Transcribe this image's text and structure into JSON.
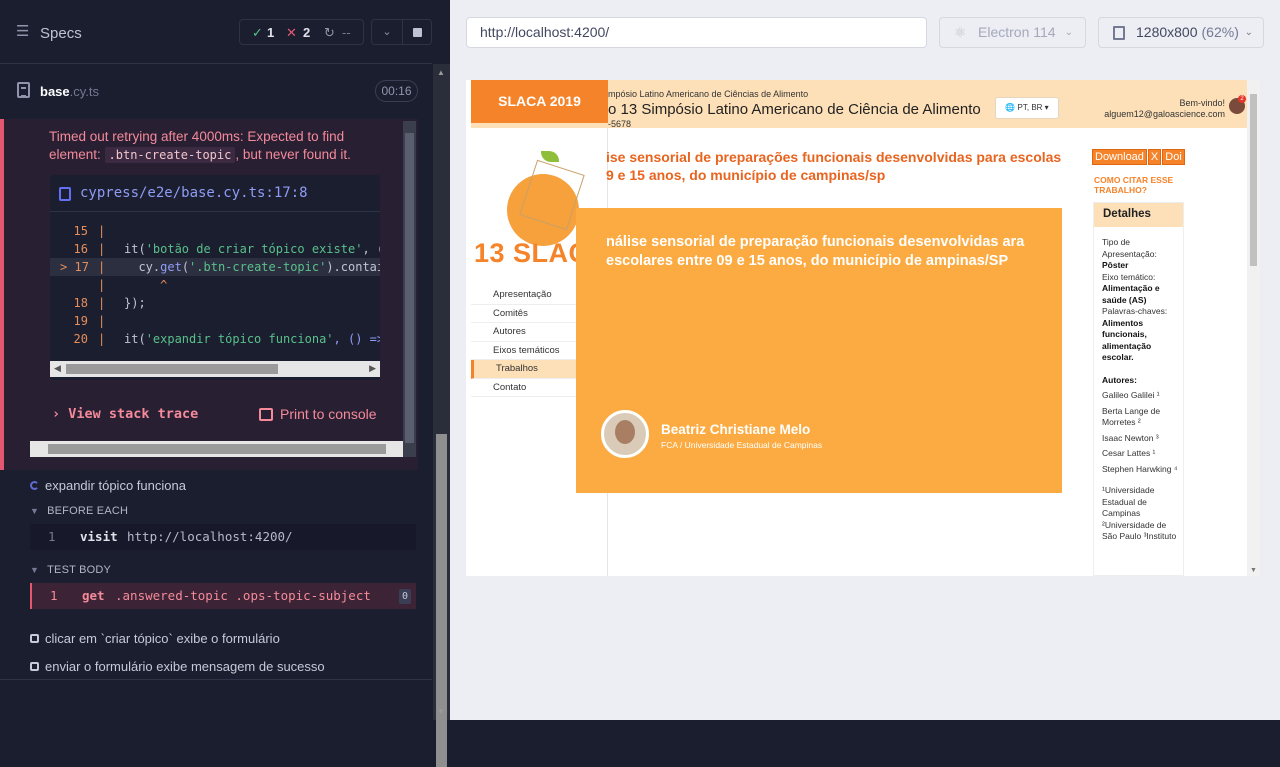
{
  "runner": {
    "specs_label": "Specs",
    "passed": "1",
    "failed": "2",
    "pending": "--",
    "spec_file": "base",
    "spec_ext": ".cy.ts",
    "duration": "00:16"
  },
  "error": {
    "message_before": "Timed out retrying after 4000ms: Expected to find element: ",
    "selector": ".btn-create-topic",
    "message_after": ", but never found it.",
    "file_link": "cypress/e2e/base.cy.ts:17:8",
    "code_lines": [
      {
        "num": "15",
        "arrow": "",
        "text": ""
      },
      {
        "num": "16",
        "arrow": "",
        "pre": "it(",
        "str": "'botão de criar tópico existe'",
        "post": ", ("
      },
      {
        "num": "17",
        "arrow": ">",
        "pre": "  cy.",
        "kw": "get",
        "mid": "(",
        "str": "'.btn-create-topic'",
        "post": ").contai"
      },
      {
        "num": "",
        "arrow": "",
        "text": "     ^"
      },
      {
        "num": "18",
        "arrow": "",
        "text": "});"
      },
      {
        "num": "19",
        "arrow": "",
        "text": ""
      },
      {
        "num": "20",
        "arrow": "",
        "pre": "it(",
        "str": "'expandir tópico funciona'",
        "post": ", () =>"
      }
    ],
    "view_stack_trace": "View stack trace",
    "print_to_console": "Print to console"
  },
  "tests": {
    "expandir": "expandir tópico funciona",
    "before_each": "BEFORE EACH",
    "visit_num": "1",
    "visit_cmd": "visit",
    "visit_url": "http://localhost:4200/",
    "test_body": "TEST BODY",
    "get_num": "1",
    "get_cmd": "get",
    "get_arg": ".answered-topic .ops-topic-subject",
    "get_count": "0",
    "test3": "clicar em `criar tópico` exibe o formulário",
    "test4": "enviar o formulário exibe mensagem de sucesso"
  },
  "preview": {
    "url": "http://localhost:4200/",
    "browser": "Electron 114",
    "viewport": "1280x800",
    "zoom": "(62%)"
  },
  "page": {
    "logo": "SLACA 2019",
    "sub": "mpósio Latino Americano de Ciências de Alimento",
    "title": "o 13 Simpósio Latino Americano de Ciência de Alimento",
    "code": "-5678",
    "lang": "PT, BR ▾",
    "welcome": "Bem-vindo!",
    "email": "alguem12@galoascience.com",
    "badge": "2",
    "conf_logo_text": "13 SLACA",
    "nav": [
      "Apresentação",
      "Comitês",
      "Autores",
      "Eixos temáticos",
      "Trabalhos",
      "Contato"
    ],
    "article_title": "ise sensorial de preparações funcionais desenvolvidas para escolas 9 e 15 anos, do município de campinas/sp",
    "poster_title": "nálise sensorial de preparação funcionais desenvolvidas ara escolares entre 09 e 15 anos, do município de ampinas/SP",
    "author": "Beatriz Christiane Melo",
    "affiliation": "FCA / Universidade Estadual de Campinas",
    "btn_download": "Download",
    "btn_x": "X",
    "btn_doi": "Doi",
    "cite": "COMO CITAR ESSE TRABALHO?",
    "details_header": "Detalhes",
    "type_label": "Tipo de Apresentação:",
    "type_value": "Pôster",
    "axis_label": "Eixo temático:",
    "axis_value": "Alimentação e saúde (AS)",
    "keywords_label": "Palavras-chaves:",
    "keywords_value": "Alimentos funcionais, alimentação escolar.",
    "authors_label": "Autores:",
    "authors": [
      "Galileo Galilei ¹",
      "Berta Lange de Morretes ²",
      "Isaac Newton ³",
      "Cesar Lattes ¹",
      "Stephen Harwking ⁴"
    ],
    "affiliations": "¹Universidade Estadual de Campinas ²Universidade de São Paulo ³Instituto"
  },
  "colors": {
    "accent": "#f5832a",
    "fail": "#e45770",
    "pass": "#59c08b"
  }
}
